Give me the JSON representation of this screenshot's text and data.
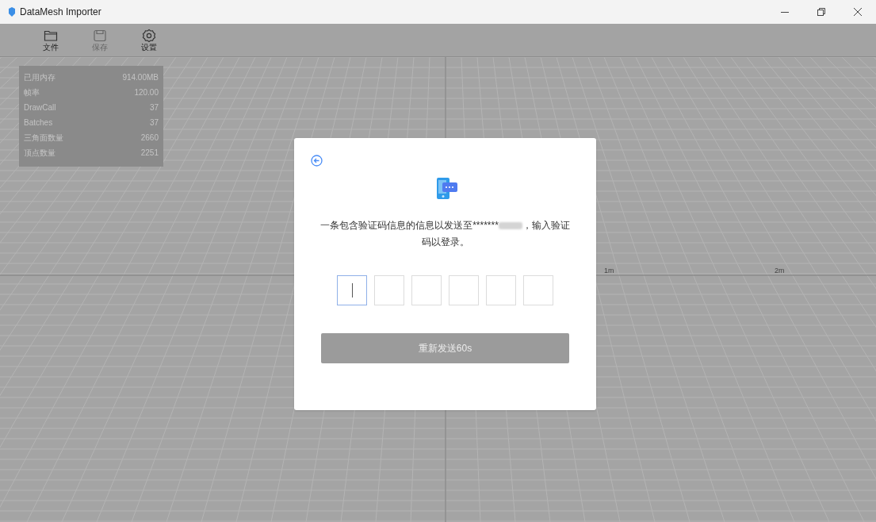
{
  "window": {
    "title": "DataMesh Importer"
  },
  "toolbar": [
    {
      "label": "文件",
      "disabled": false,
      "kind": "folder"
    },
    {
      "label": "保存",
      "disabled": true,
      "kind": "save"
    },
    {
      "label": "设置",
      "disabled": false,
      "kind": "settings"
    }
  ],
  "stats": [
    {
      "label": "已用内存",
      "value": "914.00MB"
    },
    {
      "label": "帧率",
      "value": "120.00"
    },
    {
      "label": "DrawCall",
      "value": "37"
    },
    {
      "label": "Batches",
      "value": "37"
    },
    {
      "label": "三角面数量",
      "value": "2660"
    },
    {
      "label": "顶点数量",
      "value": "2251"
    }
  ],
  "axis_labels": [
    "1m",
    "2m"
  ],
  "dialog": {
    "message_before": "一条包含验证码信息的信息以发送至*******",
    "message_after": "，输入验证码以登录。",
    "code_boxes": [
      {
        "focused": true
      },
      {
        "focused": false
      },
      {
        "focused": false
      },
      {
        "focused": false
      },
      {
        "focused": false
      },
      {
        "focused": false
      }
    ],
    "button": {
      "label": "重新发送60s",
      "disabled": true
    }
  }
}
